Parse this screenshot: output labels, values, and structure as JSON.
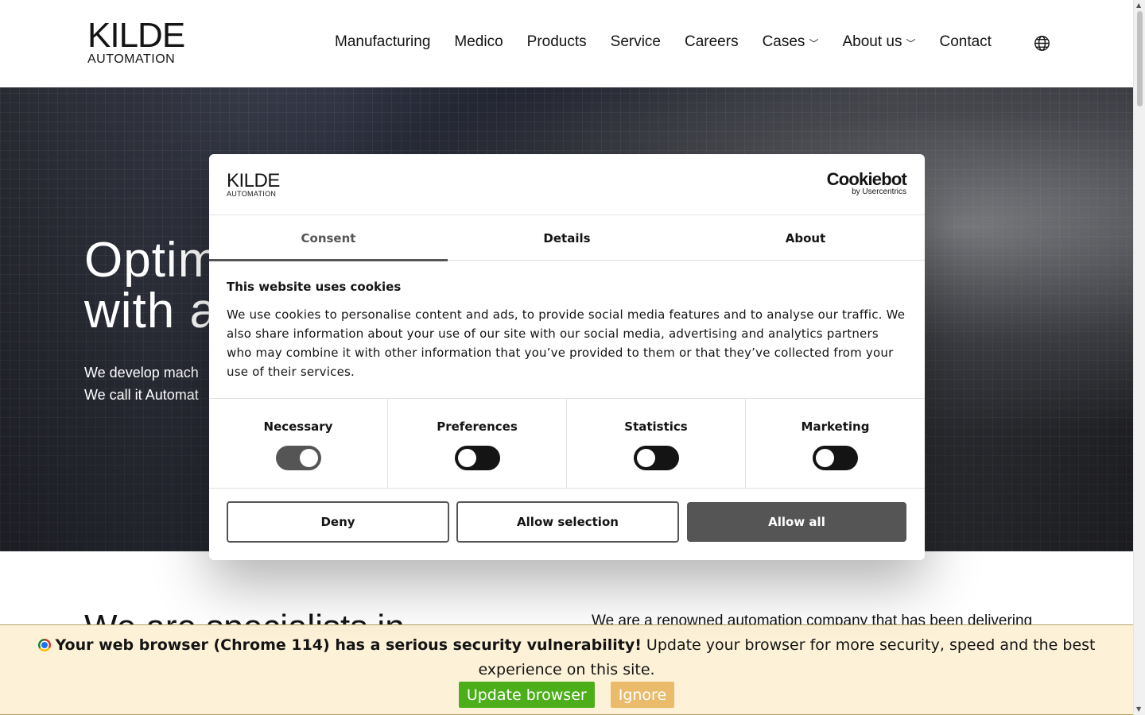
{
  "header": {
    "logo_main": "KILDE",
    "logo_sub": "AUTOMATION",
    "nav": [
      {
        "label": "Manufacturing",
        "dropdown": false
      },
      {
        "label": "Medico",
        "dropdown": false
      },
      {
        "label": "Products",
        "dropdown": false
      },
      {
        "label": "Service",
        "dropdown": false
      },
      {
        "label": "Careers",
        "dropdown": false
      },
      {
        "label": "Cases",
        "dropdown": true
      },
      {
        "label": "About us",
        "dropdown": true
      },
      {
        "label": "Contact",
        "dropdown": false
      }
    ],
    "chevron": "﹀",
    "language_icon": "globe-icon"
  },
  "hero": {
    "title_line1": "Optim",
    "title_line2": "with a",
    "sub_line1": "We develop mach",
    "sub_line2": "We call it Automat"
  },
  "below": {
    "left_heading": "We are specialists in",
    "right_text": "We are a renowned automation company that has been delivering"
  },
  "cookie_dialog": {
    "logo_main": "KILDE",
    "logo_sub": "AUTOMATION",
    "provider_name": "Cookiebot",
    "provider_by": "by Usercentrics",
    "tabs": [
      {
        "label": "Consent",
        "active": true
      },
      {
        "label": "Details",
        "active": false
      },
      {
        "label": "About",
        "active": false
      }
    ],
    "heading": "This website uses cookies",
    "body": "We use cookies to personalise content and ads, to provide social media features and to analyse our traffic. We also share information about your use of our site with our social media, advertising and analytics partners who may combine it with other information that you’ve provided to them or that they’ve collected from your use of their services.",
    "categories": [
      {
        "label": "Necessary",
        "enabled": true
      },
      {
        "label": "Preferences",
        "enabled": false
      },
      {
        "label": "Statistics",
        "enabled": false
      },
      {
        "label": "Marketing",
        "enabled": false
      }
    ],
    "buttons": {
      "deny": "Deny",
      "allow_selection": "Allow selection",
      "allow_all": "Allow all"
    }
  },
  "update_bar": {
    "bold_text": "Your web browser (Chrome 114) has a serious security vulnerability!",
    "text": "Update your browser for more security, speed and the best experience on this site.",
    "update_label": "Update browser",
    "ignore_label": "Ignore"
  },
  "colors": {
    "text": "#141414",
    "dialog_accent": "#555555",
    "update_bar_bg": "#fdf2d8",
    "update_button": "#4caf1a",
    "ignore_button": "#e9bb6a"
  }
}
